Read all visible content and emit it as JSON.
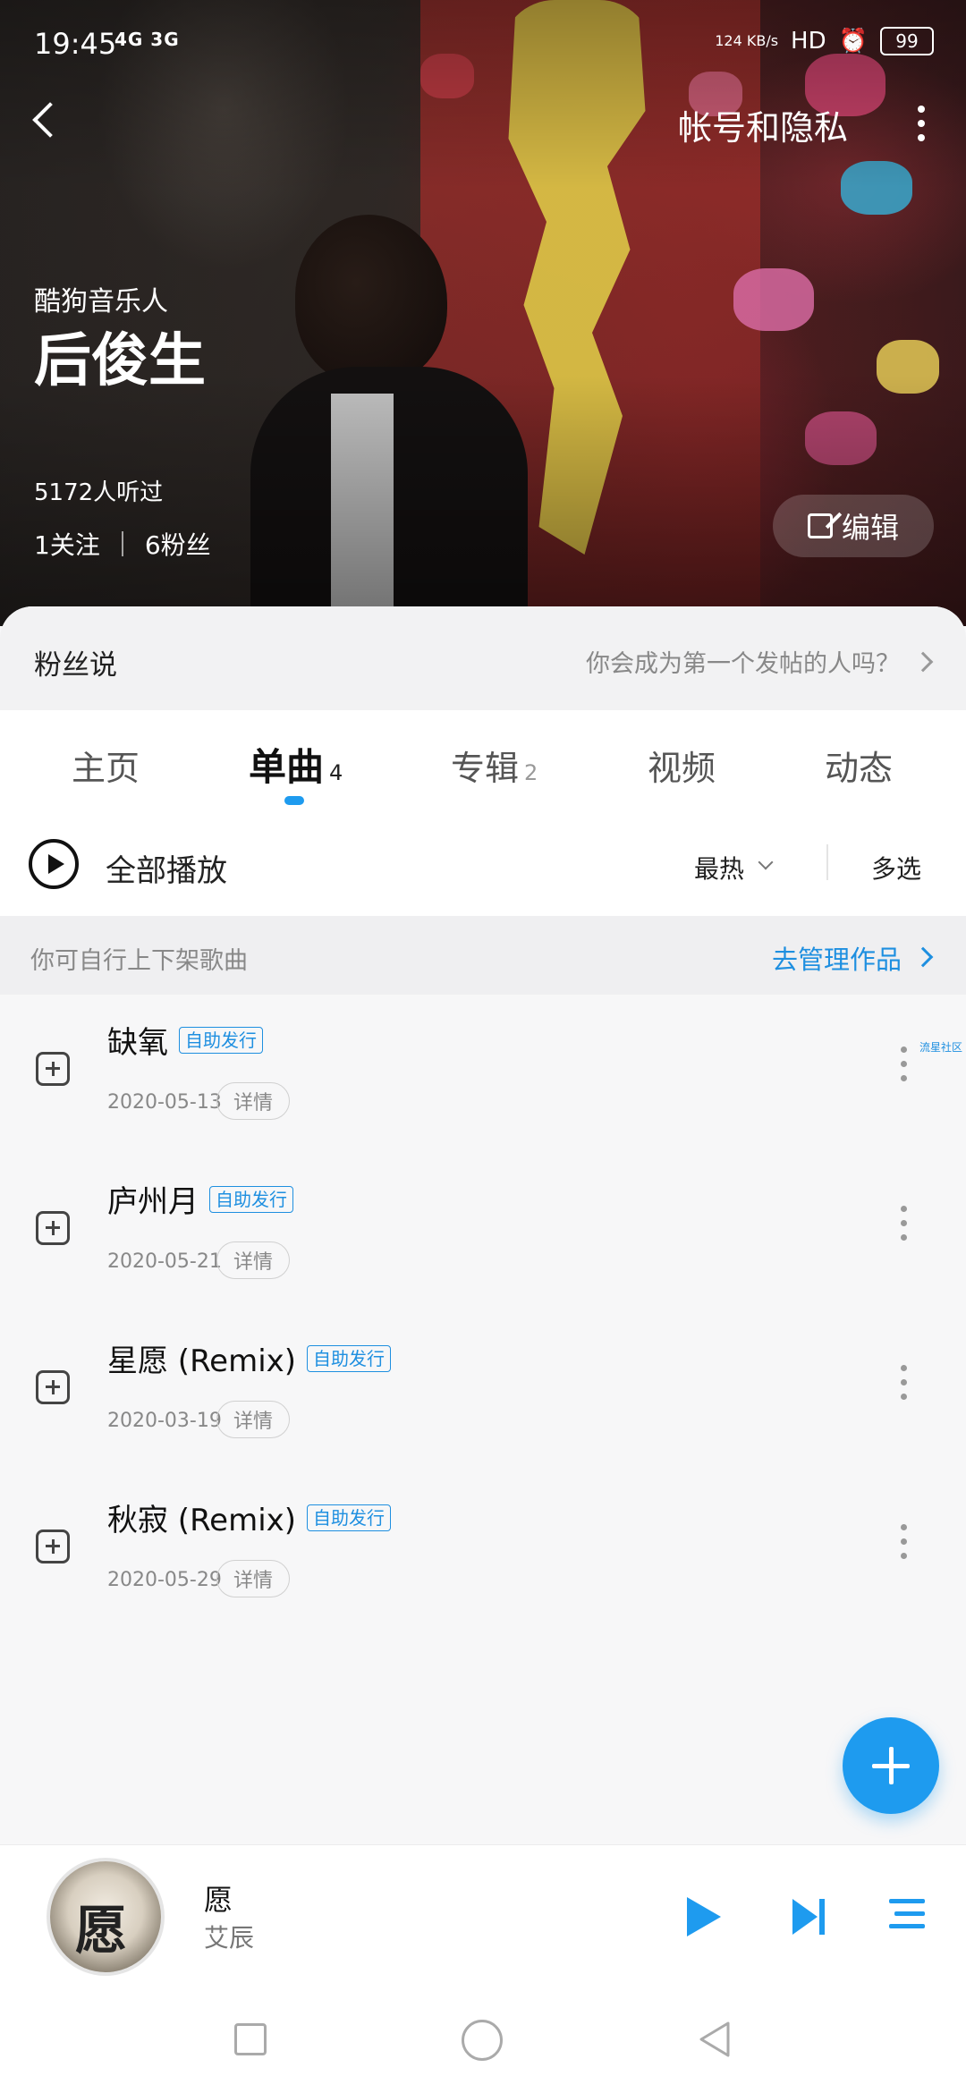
{
  "status_bar": {
    "time": "19:45",
    "signal": "4G 3G",
    "network_speed": "124 KB/s",
    "hd": "HD",
    "battery": "99"
  },
  "header": {
    "account_privacy": "帐号和隐私",
    "musician_label": "酷狗音乐人",
    "artist_name": "后俊生",
    "listened": "5172人听过",
    "following": "1关注",
    "fans": "6粉丝",
    "edit_label": "编辑"
  },
  "fans_say": {
    "title": "粉丝说",
    "hint": "你会成为第一个发帖的人吗？"
  },
  "tabs": [
    {
      "label": "主页",
      "count": ""
    },
    {
      "label": "单曲",
      "count": "4"
    },
    {
      "label": "专辑",
      "count": "2"
    },
    {
      "label": "视频",
      "count": ""
    },
    {
      "label": "动态",
      "count": ""
    }
  ],
  "play_row": {
    "play_all": "全部播放",
    "sort": "最热",
    "multi_select": "多选"
  },
  "manage": {
    "hint": "你可自行上下架歌曲",
    "link": "去管理作品"
  },
  "songs": [
    {
      "title": "缺氧",
      "badge": "自助发行",
      "date": "2020-05-13",
      "detail": "详情"
    },
    {
      "title": "庐州月",
      "badge": "自助发行",
      "date": "2020-05-21",
      "detail": "详情"
    },
    {
      "title": "星愿 (Remix)",
      "badge": "自助发行",
      "date": "2020-03-19",
      "detail": "详情"
    },
    {
      "title": "秋寂 (Remix)",
      "badge": "自助发行",
      "date": "2020-05-29",
      "detail": "详情"
    }
  ],
  "side_note": "流星社区",
  "now_playing": {
    "title": "愿",
    "artist": "艾辰",
    "album_glyph": "愿"
  },
  "colors": {
    "accent": "#1e9bef",
    "link": "#1e8fe0"
  }
}
